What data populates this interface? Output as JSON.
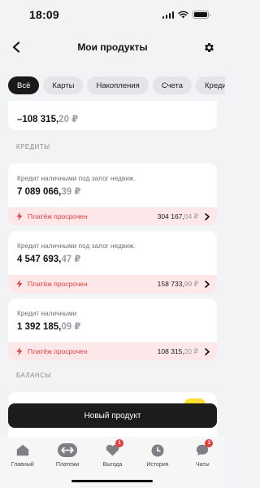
{
  "status_bar": {
    "time": "18:09"
  },
  "header": {
    "title": "Мои продукты"
  },
  "tabs": [
    {
      "label": "Всё",
      "active": true
    },
    {
      "label": "Карты",
      "active": false
    },
    {
      "label": "Накопления",
      "active": false
    },
    {
      "label": "Счета",
      "active": false
    },
    {
      "label": "Креди",
      "active": false
    }
  ],
  "top_card": {
    "amount_int": "–108 315,",
    "amount_frac": "20 ₽"
  },
  "sections": {
    "credits": "КРЕДИТЫ",
    "balances": "БАЛАНСЫ"
  },
  "loans": [
    {
      "title": "Кредит наличными под залог недвиж.",
      "amount_int": "7 089 066,",
      "amount_frac": "39 ₽",
      "status": "Платёж просрочен",
      "overdue_int": "304 167,",
      "overdue_frac": "04 ₽"
    },
    {
      "title": "Кредит наличными под залог недвиж.",
      "amount_int": "4 547 693,",
      "amount_frac": "47 ₽",
      "status": "Платёж просрочен",
      "overdue_int": "158 733,",
      "overdue_frac": "99 ₽"
    },
    {
      "title": "Кредит наличными",
      "amount_int": "1 392 185,",
      "amount_frac": "09 ₽",
      "status": "Платёж просрочен",
      "overdue_int": "108 315,",
      "overdue_frac": "20 ₽"
    }
  ],
  "new_product_button": "Новый продукт",
  "bottom_nav": [
    {
      "label": "Главный",
      "icon": "home-icon"
    },
    {
      "label": "Платежи",
      "icon": "transfer-icon"
    },
    {
      "label": "Выгода",
      "icon": "heart-icon",
      "badge": "1"
    },
    {
      "label": "История",
      "icon": "clock-icon"
    },
    {
      "label": "Чаты",
      "icon": "chat-icon",
      "badge": "3"
    }
  ],
  "colors": {
    "accent_red": "#e43d3d",
    "overdue_bg": "#fde7e8",
    "primary_dark": "#1c1c1c",
    "promo_yellow": "#ffdd2d"
  }
}
